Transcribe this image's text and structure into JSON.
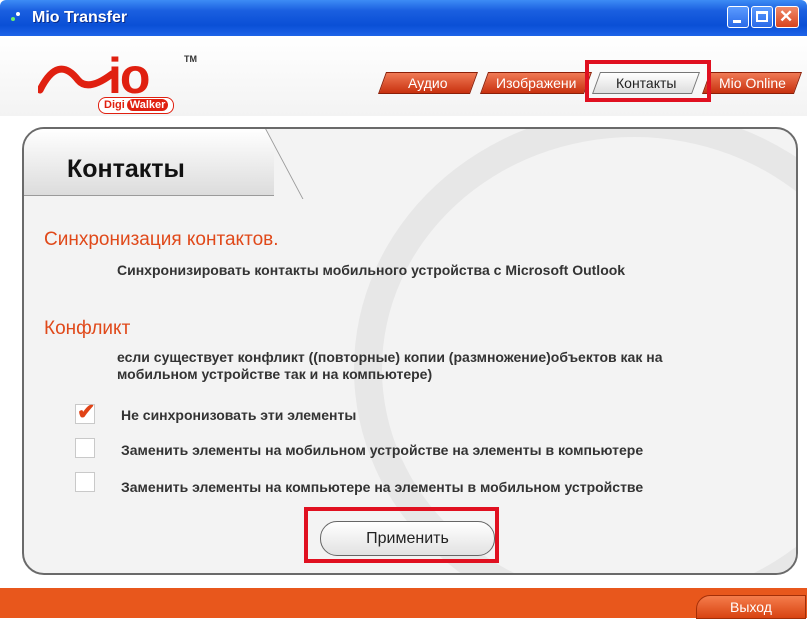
{
  "window": {
    "title": "Mio Transfer",
    "controls": {
      "minimize": "minimize",
      "maximize": "maximize",
      "close": "✕"
    }
  },
  "logo": {
    "text": "Mio",
    "tm": "TM",
    "badge_digi": "Digi",
    "badge_walker": "Walker"
  },
  "tabs": [
    {
      "label": "Аудио"
    },
    {
      "label": "Изображени"
    },
    {
      "label": "Контакты",
      "active": true
    },
    {
      "label": "Mio Online"
    }
  ],
  "panel": {
    "title": "Контакты",
    "sync_heading": "Синхронизация контактов.",
    "sync_desc": "Синхронизировать контакты мобильного устройства с Microsoft Outlook",
    "conflict_heading": "Конфликт",
    "conflict_desc_line1": "если существует конфликт ((повторные) копии (размножение)объектов как на",
    "conflict_desc_line2": "мобильном устройстве так и на компьютере)",
    "options": [
      {
        "label": "Не синхронизовать  эти элементы",
        "checked": true
      },
      {
        "label": "Заменить элементы на мобильном устройстве на элементы в компьютере",
        "checked": false
      },
      {
        "label": "Заменить элементы на компьютере на элементы в мобильном устройстве",
        "checked": false
      }
    ],
    "apply_label": "Применить"
  },
  "footer": {
    "exit_label": "Выход"
  },
  "colors": {
    "accent": "#e0491a",
    "titlebar": "#0a4fd6",
    "highlight": "#e01020"
  }
}
